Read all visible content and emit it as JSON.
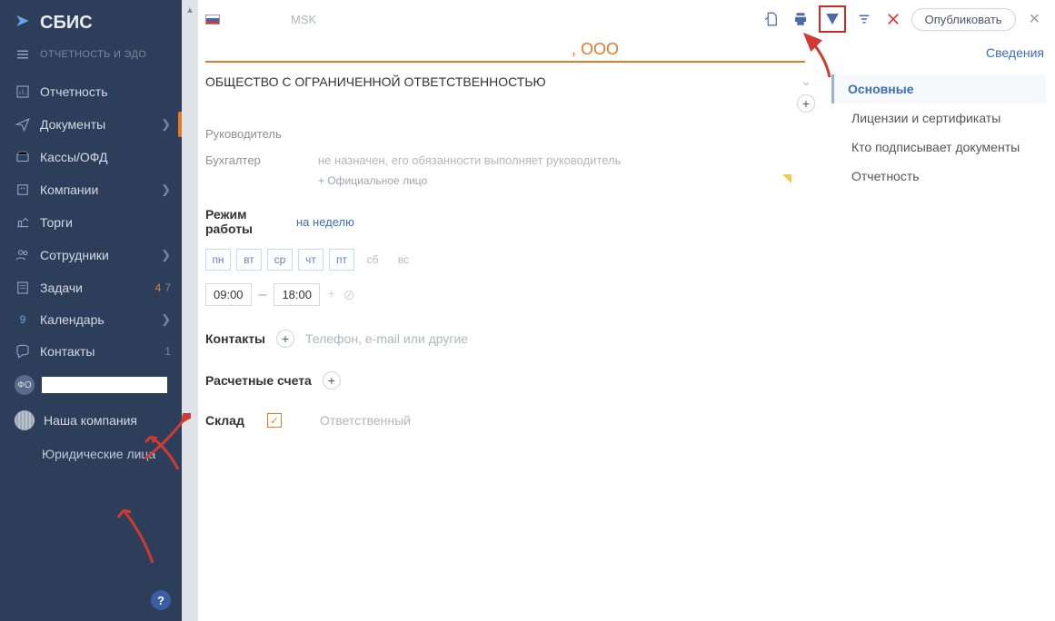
{
  "logo": {
    "text": "СБИС",
    "subtitle": "ОТЧЕТНОСТЬ И ЭДО"
  },
  "nav": {
    "report": "Отчетность",
    "documents": "Документы",
    "kassy": "Кассы/ОФД",
    "companies": "Компании",
    "torgi": "Торги",
    "employees": "Сотрудники",
    "tasks": "Задачи",
    "tasks_b1": "4",
    "tasks_b2": "7",
    "calendar": "Календарь",
    "calendar_b": "9",
    "contacts": "Контакты",
    "contacts_b": "1",
    "fo": "ФО",
    "our_company": "Наша компания",
    "legal": "Юридические лица",
    "help": "?"
  },
  "topbar": {
    "tz": "MSK",
    "publish": "Опубликовать"
  },
  "form": {
    "ooo_suffix": ", OOO",
    "org_type": "ОБЩЕСТВО С ОГРАНИЧЕННОЙ ОТВЕТСТВЕННОСТЬЮ",
    "leader_label": "Руководитель",
    "accountant_label": "Бухгалтер",
    "accountant_hint": "не назначен, его обязанности выполняет руководитель",
    "add_official": "+ Официальное лицо",
    "schedule_label": "Режим работы",
    "schedule_link": "на неделю",
    "days": {
      "mo": "пн",
      "tu": "вт",
      "we": "ср",
      "th": "чт",
      "fr": "пт",
      "sa": "сб",
      "su": "вс"
    },
    "time_from": "09:00",
    "time_to": "18:00",
    "contacts_label": "Контакты",
    "contacts_placeholder": "Телефон, e-mail или другие",
    "accounts_label": "Расчетные счета",
    "stock_label": "Склад",
    "stock_hint": "Ответственный"
  },
  "rpanel": {
    "header": "Сведения",
    "main": "Основные",
    "licenses": "Лицензии и сертификаты",
    "signers": "Кто подписывает документы",
    "reporting": "Отчетность"
  }
}
